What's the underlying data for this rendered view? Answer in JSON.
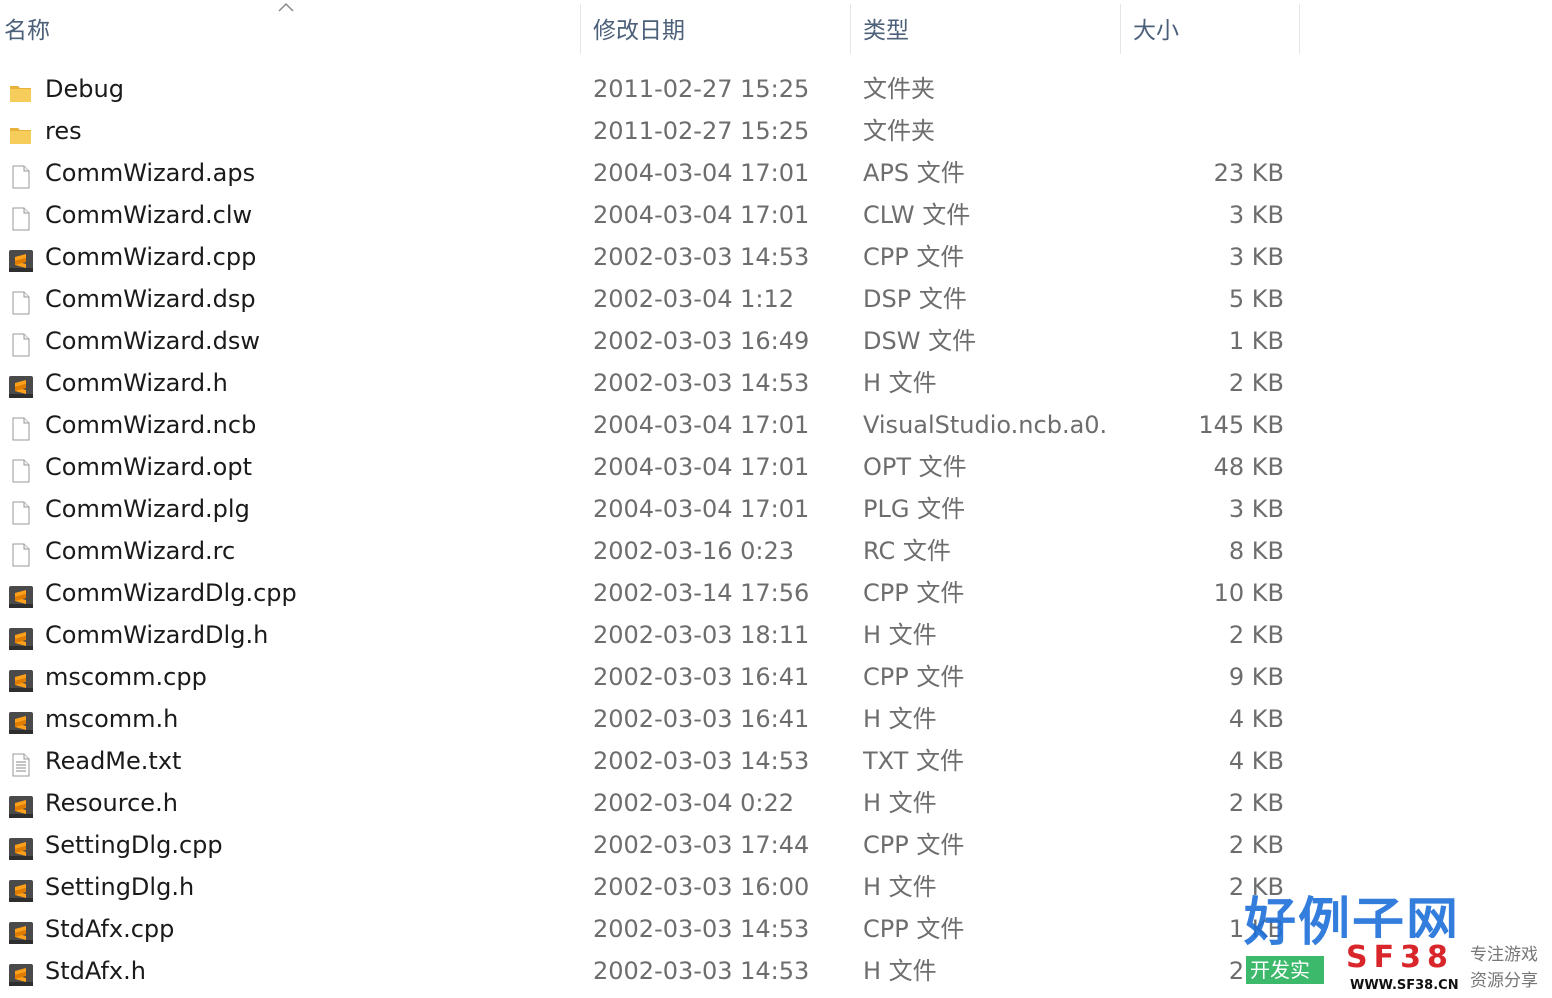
{
  "columns": {
    "name": "名称",
    "date": "修改日期",
    "type": "类型",
    "size": "大小"
  },
  "files": [
    {
      "name": "Debug",
      "date": "2011-02-27 15:25",
      "type": "文件夹",
      "size": "",
      "icon": "folder-icon"
    },
    {
      "name": "res",
      "date": "2011-02-27 15:25",
      "type": "文件夹",
      "size": "",
      "icon": "folder-icon"
    },
    {
      "name": "CommWizard.aps",
      "date": "2004-03-04 17:01",
      "type": "APS 文件",
      "size": "23 KB",
      "icon": "blank-file-icon"
    },
    {
      "name": "CommWizard.clw",
      "date": "2004-03-04 17:01",
      "type": "CLW 文件",
      "size": "3 KB",
      "icon": "blank-file-icon"
    },
    {
      "name": "CommWizard.cpp",
      "date": "2002-03-03 14:53",
      "type": "CPP 文件",
      "size": "3 KB",
      "icon": "sublime-file-icon"
    },
    {
      "name": "CommWizard.dsp",
      "date": "2002-03-04 1:12",
      "type": "DSP 文件",
      "size": "5 KB",
      "icon": "blank-file-icon"
    },
    {
      "name": "CommWizard.dsw",
      "date": "2002-03-03 16:49",
      "type": "DSW 文件",
      "size": "1 KB",
      "icon": "blank-file-icon"
    },
    {
      "name": "CommWizard.h",
      "date": "2002-03-03 14:53",
      "type": "H 文件",
      "size": "2 KB",
      "icon": "sublime-file-icon"
    },
    {
      "name": "CommWizard.ncb",
      "date": "2004-03-04 17:01",
      "type": "VisualStudio.ncb.a0...",
      "size": "145 KB",
      "icon": "blank-file-icon"
    },
    {
      "name": "CommWizard.opt",
      "date": "2004-03-04 17:01",
      "type": "OPT 文件",
      "size": "48 KB",
      "icon": "blank-file-icon"
    },
    {
      "name": "CommWizard.plg",
      "date": "2004-03-04 17:01",
      "type": "PLG 文件",
      "size": "3 KB",
      "icon": "blank-file-icon"
    },
    {
      "name": "CommWizard.rc",
      "date": "2002-03-16 0:23",
      "type": "RC 文件",
      "size": "8 KB",
      "icon": "blank-file-icon"
    },
    {
      "name": "CommWizardDlg.cpp",
      "date": "2002-03-14 17:56",
      "type": "CPP 文件",
      "size": "10 KB",
      "icon": "sublime-file-icon"
    },
    {
      "name": "CommWizardDlg.h",
      "date": "2002-03-03 18:11",
      "type": "H 文件",
      "size": "2 KB",
      "icon": "sublime-file-icon"
    },
    {
      "name": "mscomm.cpp",
      "date": "2002-03-03 16:41",
      "type": "CPP 文件",
      "size": "9 KB",
      "icon": "sublime-file-icon"
    },
    {
      "name": "mscomm.h",
      "date": "2002-03-03 16:41",
      "type": "H 文件",
      "size": "4 KB",
      "icon": "sublime-file-icon"
    },
    {
      "name": "ReadMe.txt",
      "date": "2002-03-03 14:53",
      "type": "TXT 文件",
      "size": "4 KB",
      "icon": "text-file-icon"
    },
    {
      "name": "Resource.h",
      "date": "2002-03-04 0:22",
      "type": "H 文件",
      "size": "2 KB",
      "icon": "sublime-file-icon"
    },
    {
      "name": "SettingDlg.cpp",
      "date": "2002-03-03 17:44",
      "type": "CPP 文件",
      "size": "2 KB",
      "icon": "sublime-file-icon"
    },
    {
      "name": "SettingDlg.h",
      "date": "2002-03-03 16:00",
      "type": "H 文件",
      "size": "2 KB",
      "icon": "sublime-file-icon"
    },
    {
      "name": "StdAfx.cpp",
      "date": "2002-03-03 14:53",
      "type": "CPP 文件",
      "size": "1 KB",
      "icon": "sublime-file-icon"
    },
    {
      "name": "StdAfx.h",
      "date": "2002-03-03 14:53",
      "type": "H 文件",
      "size": "2 KB",
      "icon": "sublime-file-icon"
    }
  ],
  "watermark": {
    "title": "好例子网",
    "brand": "SF38",
    "url": "WWW.SF38.CN",
    "left_text": "开发实",
    "right_line1": "专注游戏",
    "right_line2": "资源分享"
  },
  "colors": {
    "header_text": "#4c607a",
    "name_text": "#1a1a1a",
    "meta_text": "#6d6d6d",
    "folder": "#f4c54a",
    "sublime": "#ff9800"
  }
}
